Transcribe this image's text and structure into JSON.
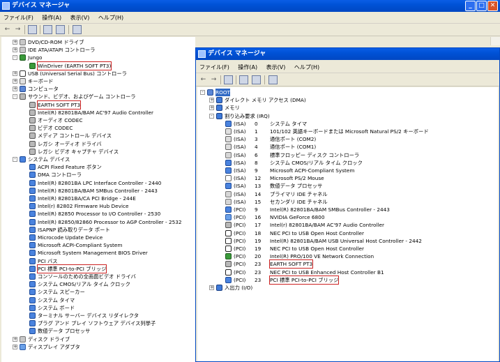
{
  "back_window": {
    "title": "デバイス マネージャ",
    "menu": [
      "ファイル(F)",
      "操作(A)",
      "表示(V)",
      "ヘルプ(H)"
    ],
    "tree": [
      {
        "label": "DVD/CD-ROM ドライブ",
        "level": 0,
        "exp": "+",
        "icon": "drive"
      },
      {
        "label": "IDE ATA/ATAPI コントローラ",
        "level": 0,
        "exp": "+",
        "icon": "drive"
      },
      {
        "label": "Jungo",
        "level": 0,
        "exp": "-",
        "icon": "card"
      },
      {
        "label": "WinDriver (EARTH SOFT PT3)",
        "level": 1,
        "icon": "card",
        "hl": true
      },
      {
        "label": "USB (Universal Serial Bus) コントローラ",
        "level": 0,
        "exp": "+",
        "icon": "usb"
      },
      {
        "label": "キーボード",
        "level": 0,
        "exp": "+",
        "icon": "kbd"
      },
      {
        "label": "コンピュータ",
        "level": 0,
        "exp": "+",
        "icon": "pc"
      },
      {
        "label": "サウンド、ビデオ、およびゲーム コントローラ",
        "level": 0,
        "exp": "-",
        "icon": "snd"
      },
      {
        "label": "EARTH SOFT PT3",
        "level": 1,
        "icon": "snd",
        "hl": true
      },
      {
        "label": "Intel(R) 82801BA/BAM AC'97 Audio Controller",
        "level": 1,
        "icon": "snd"
      },
      {
        "label": "オーディオ CODEC",
        "level": 1,
        "icon": "snd"
      },
      {
        "label": "ビデオ CODEC",
        "level": 1,
        "icon": "snd"
      },
      {
        "label": "メディア コントロール デバイス",
        "level": 1,
        "icon": "snd"
      },
      {
        "label": "レガシ オーディオ ドライバ",
        "level": 1,
        "icon": "snd"
      },
      {
        "label": "レガシ ビデオ キャプチャ デバイス",
        "level": 1,
        "icon": "snd"
      },
      {
        "label": "システム デバイス",
        "level": 0,
        "exp": "-",
        "icon": "sys"
      },
      {
        "label": "ACPI Fixed Feature ボタン",
        "level": 1,
        "icon": "sys"
      },
      {
        "label": "DMA コントローラ",
        "level": 1,
        "icon": "sys"
      },
      {
        "label": "Intel(R) 82801BA LPC Interface Controller - 2440",
        "level": 1,
        "icon": "sys"
      },
      {
        "label": "Intel(R) 82801BA/BAM SMBus Controller - 2443",
        "level": 1,
        "icon": "sys"
      },
      {
        "label": "Intel(R) 82801BA/CA PCI Bridge - 244E",
        "level": 1,
        "icon": "sys"
      },
      {
        "label": "Intel(r) 82802 Firmware Hub Device",
        "level": 1,
        "icon": "sys"
      },
      {
        "label": "Intel(R) 82850 Processor to I/O Controller - 2530",
        "level": 1,
        "icon": "sys"
      },
      {
        "label": "Intel(R) 82850/82860 Processor to AGP Controller - 2532",
        "level": 1,
        "icon": "sys"
      },
      {
        "label": "ISAPNP 読み取りデータ ポート",
        "level": 1,
        "icon": "sys"
      },
      {
        "label": "Microcode Update Device",
        "level": 1,
        "icon": "sys"
      },
      {
        "label": "Microsoft ACPI-Compliant System",
        "level": 1,
        "icon": "sys"
      },
      {
        "label": "Microsoft System Management BIOS Driver",
        "level": 1,
        "icon": "sys"
      },
      {
        "label": "PCI バス",
        "level": 1,
        "icon": "sys"
      },
      {
        "label": "PCI 標準 PCI-to-PCI ブリッジ",
        "level": 1,
        "icon": "sys",
        "hl": true
      },
      {
        "label": "コンソールのための全画面ビデオ ドライバ",
        "level": 1,
        "icon": "sys"
      },
      {
        "label": "システム CMOS/リアル タイム クロック",
        "level": 1,
        "icon": "sys"
      },
      {
        "label": "システム スピーカー",
        "level": 1,
        "icon": "sys"
      },
      {
        "label": "システム タイマ",
        "level": 1,
        "icon": "sys"
      },
      {
        "label": "システム ボード",
        "level": 1,
        "icon": "sys"
      },
      {
        "label": "ターミナル サーバー デバイス リダイレクタ",
        "level": 1,
        "icon": "sys"
      },
      {
        "label": "プラグ アンド プレイ ソフトウェア デバイス列挙子",
        "level": 1,
        "icon": "sys"
      },
      {
        "label": "数値データ プロセッサ",
        "level": 1,
        "icon": "sys"
      },
      {
        "label": "ディスク ドライブ",
        "level": 0,
        "exp": "+",
        "icon": "drive"
      },
      {
        "label": "ディスプレイ アダプタ",
        "level": 0,
        "exp": "+",
        "icon": "mon"
      }
    ]
  },
  "front_window": {
    "title": "デバイス マネージャ",
    "menu": [
      "ファイル(F)",
      "操作(A)",
      "表示(V)",
      "ヘルプ(H)"
    ],
    "tree": [
      {
        "label": "ROOT",
        "level": 0,
        "exp": "-",
        "icon": "pc",
        "sel": true
      },
      {
        "label": "ダイレクト メモリ アクセス (DMA)",
        "level": 1,
        "exp": "+",
        "icon": "irq"
      },
      {
        "label": "メモリ",
        "level": 1,
        "exp": "+",
        "icon": "irq"
      },
      {
        "label": "割り込み要求 (IRQ)",
        "level": 1,
        "exp": "-",
        "icon": "irq"
      },
      {
        "irq": "(ISA)",
        "num": "0",
        "label": "システム タイマ",
        "level": 2,
        "icon": "sys"
      },
      {
        "irq": "(ISA)",
        "num": "1",
        "label": "101/102 英語キーボードまたは Microsoft Natural PS/2 キーボード",
        "level": 2,
        "icon": "kbd"
      },
      {
        "irq": "(ISA)",
        "num": "3",
        "label": "通信ポート (COM2)",
        "level": 2,
        "icon": "port"
      },
      {
        "irq": "(ISA)",
        "num": "4",
        "label": "通信ポート (COM1)",
        "level": 2,
        "icon": "port"
      },
      {
        "irq": "(ISA)",
        "num": "6",
        "label": "標準フロッピー ディスク コントローラ",
        "level": 2,
        "icon": "hdd"
      },
      {
        "irq": "(ISA)",
        "num": "8",
        "label": "システム CMOS/リアル タイム クロック",
        "level": 2,
        "icon": "sys"
      },
      {
        "irq": "(ISA)",
        "num": "9",
        "label": "Microsoft ACPI-Compliant System",
        "level": 2,
        "icon": "sys"
      },
      {
        "irq": "(ISA)",
        "num": "12",
        "label": "Microsoft PS/2 Mouse",
        "level": 2,
        "icon": "mouse"
      },
      {
        "irq": "(ISA)",
        "num": "13",
        "label": "数値データ プロセッサ",
        "level": 2,
        "icon": "sys"
      },
      {
        "irq": "(ISA)",
        "num": "14",
        "label": "プライマリ IDE チャネル",
        "level": 2,
        "icon": "hdd"
      },
      {
        "irq": "(ISA)",
        "num": "15",
        "label": "セカンダリ IDE チャネル",
        "level": 2,
        "icon": "hdd"
      },
      {
        "irq": "(PCI)",
        "num": "9",
        "label": "Intel(R) 82801BA/BAM SMBus Controller - 2443",
        "level": 2,
        "icon": "sys"
      },
      {
        "irq": "(PCI)",
        "num": "16",
        "label": "NVIDIA GeForce 6800",
        "level": 2,
        "icon": "mon"
      },
      {
        "irq": "(PCI)",
        "num": "17",
        "label": "Intel(r) 82801BA/BAM AC'97 Audio Controller",
        "level": 2,
        "icon": "snd"
      },
      {
        "irq": "(PCI)",
        "num": "18",
        "label": "NEC PCI to USB Open Host Controller",
        "level": 2,
        "icon": "usbh"
      },
      {
        "irq": "(PCI)",
        "num": "19",
        "label": "Intel(R) 82801BA/BAM USB Universal Host Controller - 2442",
        "level": 2,
        "icon": "usbh"
      },
      {
        "irq": "(PCI)",
        "num": "19",
        "label": "NEC PCI to USB Open Host Controller",
        "level": 2,
        "icon": "usbh"
      },
      {
        "irq": "(PCI)",
        "num": "20",
        "label": "Intel(R) PRO/100 VE Network Connection",
        "level": 2,
        "icon": "net"
      },
      {
        "irq": "(PCI)",
        "num": "23",
        "label": "EARTH SOFT PT3",
        "level": 2,
        "icon": "snd",
        "hl": true
      },
      {
        "irq": "(PCI)",
        "num": "23",
        "label": "NEC PCI to USB Enhanced Host Controller B1",
        "level": 2,
        "icon": "usbh"
      },
      {
        "irq": "(PCI)",
        "num": "23",
        "label": "PCI 標準 PCI-to-PCI ブリッジ",
        "level": 2,
        "icon": "sys",
        "hl": true
      },
      {
        "label": "入出力 (I/O)",
        "level": 1,
        "exp": "+",
        "icon": "io"
      }
    ]
  }
}
